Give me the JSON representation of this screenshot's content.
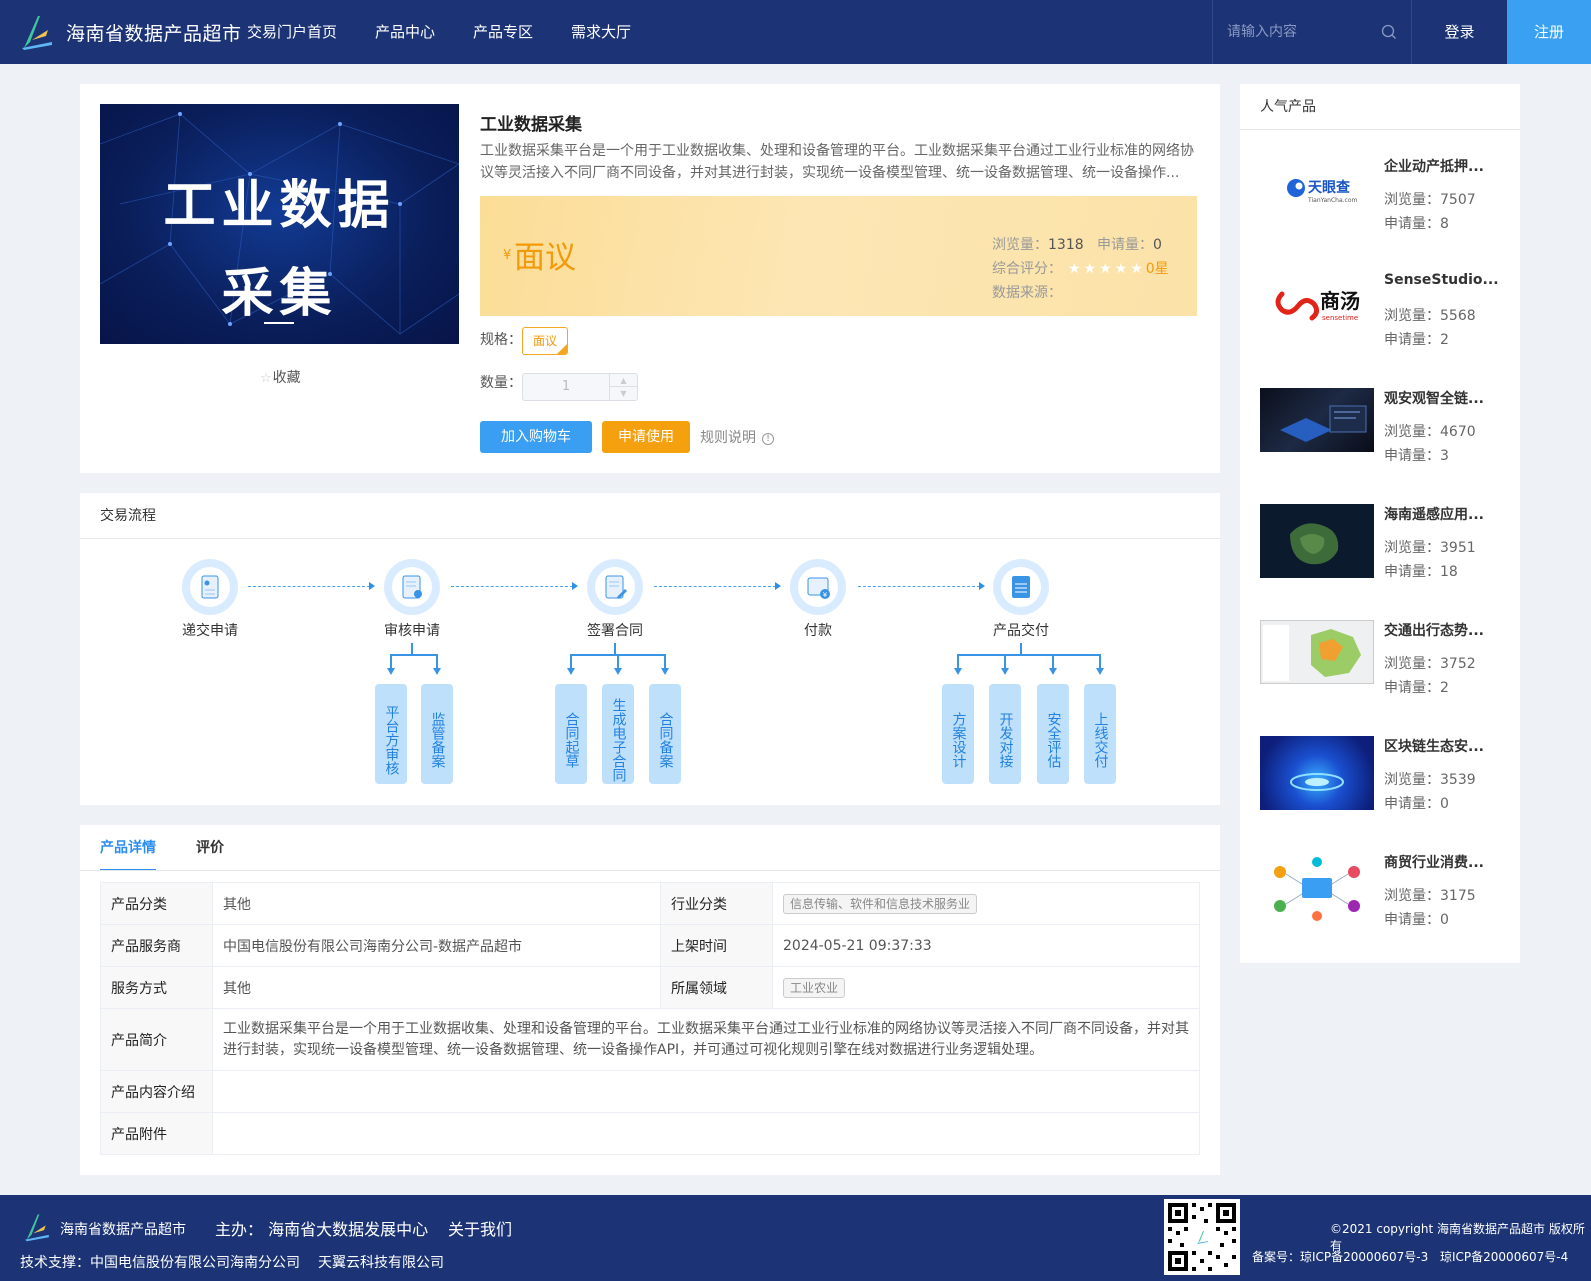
{
  "header": {
    "site_title": "海南省数据产品超市",
    "nav": [
      "交易门户首页",
      "产品中心",
      "产品专区",
      "需求大厅"
    ],
    "search_placeholder": "请输入内容",
    "login": "登录",
    "register": "注册"
  },
  "product": {
    "cover_text_line1": "工业数据",
    "cover_text_line2": "采集",
    "favorite": "收藏",
    "name": "工业数据采集",
    "desc": "工业数据采集平台是一个用于工业数据收集、处理和设备管理的平台。工业数据采集平台通过工业行业标准的网络协议等灵活接入不同厂商不同设备，并对其进行封装，实现统一设备模型管理、统一设备数据管理、统一设备操作...",
    "currency": "¥",
    "price": "面议",
    "views_label": "浏览量：",
    "views": "1318",
    "apply_label": "申请量：",
    "apply": "0",
    "rating_label": "综合评分：",
    "rating_stars": "★★★★★",
    "rating_value": "0星",
    "source_label": "数据来源：",
    "spec_label": "规格：",
    "spec_value": "面议",
    "qty_label": "数量：",
    "qty_value": "1",
    "add_cart": "加入购物车",
    "apply_use": "申请使用",
    "rules": "规则说明"
  },
  "flow": {
    "title": "交易流程",
    "steps": [
      "递交申请",
      "审核申请",
      "签署合同",
      "付款",
      "产品交付"
    ],
    "review_sub": [
      "平台方审核",
      "监管备案"
    ],
    "contract_sub": [
      "合同起草",
      "生成电子合同",
      "合同备案"
    ],
    "delivery_sub": [
      "方案设计",
      "开发对接",
      "安全评估",
      "上线交付"
    ]
  },
  "tabs": {
    "detail": "产品详情",
    "review": "评价"
  },
  "detail": {
    "category_label": "产品分类",
    "category": "其他",
    "industry_label": "行业分类",
    "industry": "信息传输、软件和信息技术服务业",
    "provider_label": "产品服务商",
    "provider": "中国电信股份有限公司海南分公司-数据产品超市",
    "listed_label": "上架时间",
    "listed": "2024-05-21 09:37:33",
    "service_label": "服务方式",
    "service": "其他",
    "domain_label": "所属领域",
    "domain": "工业农业",
    "intro_label": "产品简介",
    "intro": "工业数据采集平台是一个用于工业数据收集、处理和设备管理的平台。工业数据采集平台通过工业行业标准的网络协议等灵活接入不同厂商不同设备，并对其进行封装，实现统一设备模型管理、统一设备数据管理、统一设备操作API，并可通过可视化规则引擎在线对数据进行业务逻辑处理。",
    "content_label": "产品内容介绍",
    "attach_label": "产品附件"
  },
  "popular": {
    "title": "人气产品",
    "items": [
      {
        "name": "企业动产抵押...",
        "views": "浏览量：7507",
        "apply": "申请量：8"
      },
      {
        "name": "SenseStudio...",
        "views": "浏览量：5568",
        "apply": "申请量：2"
      },
      {
        "name": "观安观智全链...",
        "views": "浏览量：4670",
        "apply": "申请量：3"
      },
      {
        "name": "海南遥感应用...",
        "views": "浏览量：3951",
        "apply": "申请量：18"
      },
      {
        "name": "交通出行态势...",
        "views": "浏览量：3752",
        "apply": "申请量：2"
      },
      {
        "name": "区块链生态安...",
        "views": "浏览量：3539",
        "apply": "申请量：0"
      },
      {
        "name": "商贸行业消费...",
        "views": "浏览量：3175",
        "apply": "申请量：0"
      }
    ],
    "logo_tianyancha": "天眼查",
    "logo_tianyancha_sub": "TianYanCha.com",
    "logo_sensetime": "商汤",
    "logo_sensetime_sub": "sensetime"
  },
  "footer": {
    "name": "海南省数据产品超市",
    "host": "主办： 海南省大数据发展中心",
    "about": "关于我们",
    "tech1": "技术支撑：中国电信股份有限公司海南分公司",
    "tech2": "天翼云科技有限公司",
    "copyright": "©2021 copyright 海南省数据产品超市 版权所有",
    "icp1": "备案号：琼ICP备20000607号-3",
    "icp2": "琼ICP备20000607号-4"
  },
  "colors": {
    "header_bg": "#1c3476",
    "accent": "#3aa0f2",
    "price": "#f39a0b",
    "flow_blue": "#3a94e6"
  }
}
